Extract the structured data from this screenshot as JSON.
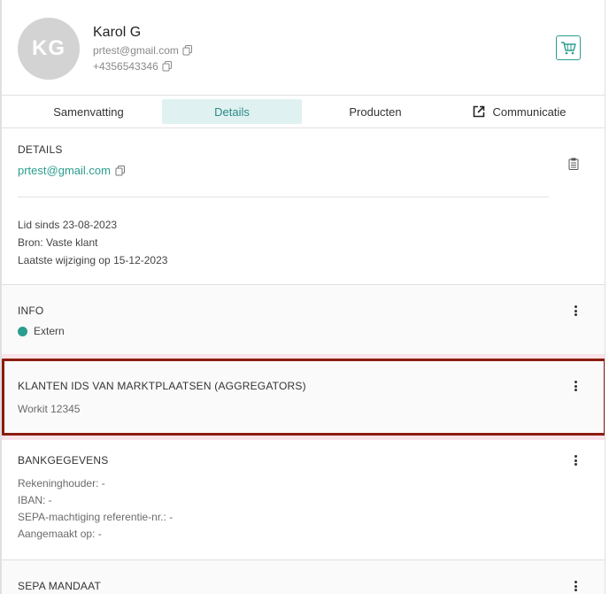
{
  "profile": {
    "initials": "KG",
    "name": "Karol G",
    "email": "prtest@gmail.com",
    "phone": "+4356543346"
  },
  "tabs": [
    {
      "label": "Samenvatting",
      "active": false
    },
    {
      "label": "Details",
      "active": true
    },
    {
      "label": "Producten",
      "active": false
    },
    {
      "label": "Communicatie",
      "active": false,
      "icon": "external-link-icon"
    }
  ],
  "details": {
    "title": "DETAILS",
    "email": "prtest@gmail.com",
    "member_since": "Lid sinds 23-08-2023",
    "source": "Bron: Vaste klant",
    "last_modified": "Laatste wijziging op 15-12-2023"
  },
  "info": {
    "title": "INFO",
    "status_label": "Extern"
  },
  "aggregators": {
    "title": "KLANTEN IDS VAN MARKTPLAATSEN (AGGREGATORS)",
    "entry": "Workit 12345"
  },
  "bank": {
    "title": "BANKGEGEVENS",
    "account_holder": "Rekeninghouder: -",
    "iban": "IBAN: -",
    "sepa_ref": "SEPA-machtiging referentie-nr.: -",
    "created": "Aangemaakt op: -"
  },
  "sepa": {
    "title": "SEPA MANDAAT"
  },
  "colors": {
    "accent": "#2a9d8f",
    "highlight_border": "#8b1c0f",
    "active_tab_bg": "#dff1f0"
  }
}
